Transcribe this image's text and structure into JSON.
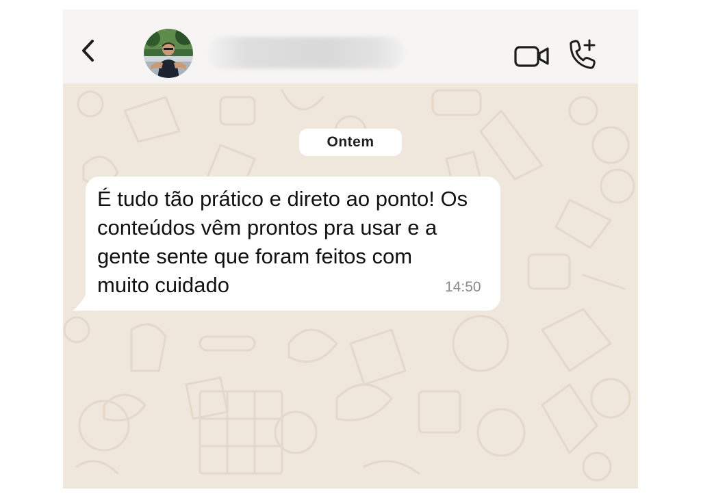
{
  "header": {
    "back_icon": "chevron-left-icon",
    "contact_name": "",
    "video_icon": "video-camera-icon",
    "add_call_icon": "phone-plus-icon"
  },
  "chat": {
    "date_label": "Ontem",
    "messages": [
      {
        "direction": "incoming",
        "lines": [
          "É tudo tão prático e direto ao ponto! Os",
          "conteúdos vêm prontos pra usar e a",
          "gente sente que foram feitos com",
          "muito cuidado"
        ],
        "time": "14:50"
      }
    ]
  },
  "colors": {
    "header_bg": "#f6f5f3",
    "chat_bg": "#efe7dc",
    "bubble_bg": "#ffffff",
    "icon_color": "#1d1d1d",
    "time_color": "#8b8b8b"
  }
}
